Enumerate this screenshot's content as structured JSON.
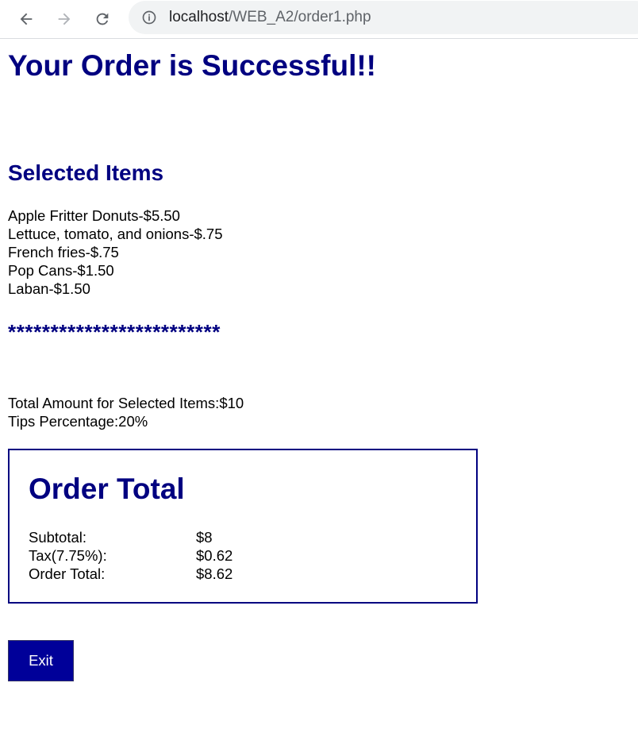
{
  "browser": {
    "url_host": "localhost",
    "url_path": "/WEB_A2/order1.php",
    "back_icon": "arrow-left-icon",
    "forward_icon": "arrow-right-icon",
    "reload_icon": "reload-icon",
    "info_icon": "info-icon"
  },
  "page": {
    "title": "Your Order is Successful!!",
    "selected_items_heading": "Selected Items",
    "items": [
      "Apple Fritter Donuts-$5.50",
      "Lettuce, tomato, and onions-$.75",
      "French fries-$.75",
      "Pop Cans-$1.50",
      "Laban-$1.50"
    ],
    "separator": "*************************",
    "total_amount_line": "Total Amount for Selected Items:$10",
    "tips_line": "Tips Percentage:20%"
  },
  "order_total": {
    "heading": "Order Total",
    "rows": [
      {
        "label": "Subtotal:",
        "value": "$8"
      },
      {
        "label": "Tax(7.75%):",
        "value": "$0.62"
      },
      {
        "label": "Order Total:",
        "value": "$8.62"
      }
    ]
  },
  "actions": {
    "exit_label": "Exit"
  },
  "colors": {
    "heading": "#000080",
    "button_bg": "#000099",
    "button_text": "#ffffff"
  }
}
